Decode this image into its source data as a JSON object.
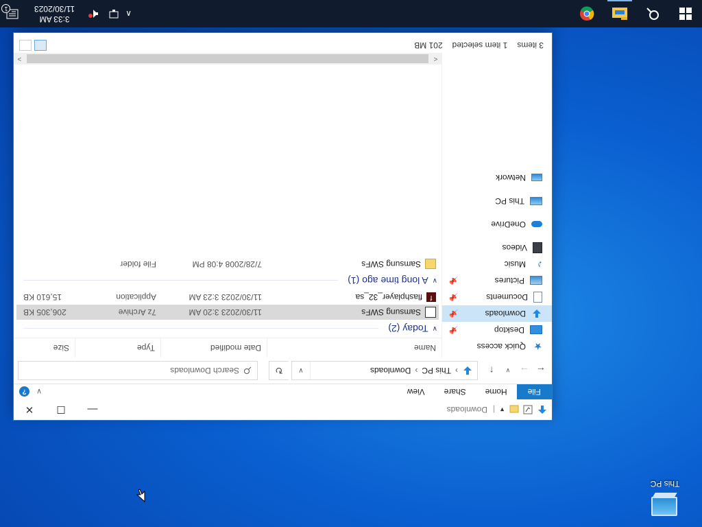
{
  "desktop": {
    "icon_label": "This PC"
  },
  "window": {
    "title": "Downloads",
    "ribbon_tabs": [
      "File",
      "Home",
      "Share",
      "View"
    ],
    "address": {
      "crumbs": [
        "This PC",
        "Downloads"
      ]
    },
    "search_placeholder": "Search Downloads",
    "nav": {
      "quick_access": "Quick access",
      "pinned": [
        "Desktop",
        "Downloads",
        "Documents",
        "Pictures"
      ],
      "others": [
        "Music",
        "Videos"
      ],
      "onedrive": "OneDrive",
      "this_pc": "This PC",
      "network": "Network"
    },
    "columns": {
      "name": "Name",
      "date": "Date modified",
      "type": "Type",
      "size": "Size"
    },
    "groups": [
      {
        "label": "Today (2)",
        "files": [
          {
            "name": "Samsung SWFs",
            "date": "11/30/2023 3:20 AM",
            "type": "7z Archive",
            "size": "206,305 KB",
            "icon": "archive-icon",
            "selected": true
          },
          {
            "name": "flashplayer_32_sa",
            "date": "11/30/2023 3:23 AM",
            "type": "Application",
            "size": "15,610 KB",
            "icon": "flash-icon",
            "selected": false
          }
        ]
      },
      {
        "label": "A long time ago (1)",
        "files": [
          {
            "name": "Samsung SWFs",
            "date": "7/28/2008 4:08 PM",
            "type": "File folder",
            "size": "",
            "icon": "folder-icon",
            "selected": false
          }
        ]
      }
    ],
    "status": {
      "items": "3 items",
      "selected": "1 item selected",
      "size": "201 MB"
    }
  },
  "taskbar": {
    "clock_time": "3:33 AM",
    "clock_date": "11/30/2023",
    "notification_count": "1"
  },
  "colors": {
    "accent": "#1979ca",
    "taskbar": "#101b2d",
    "selection": "#cce4f7"
  }
}
